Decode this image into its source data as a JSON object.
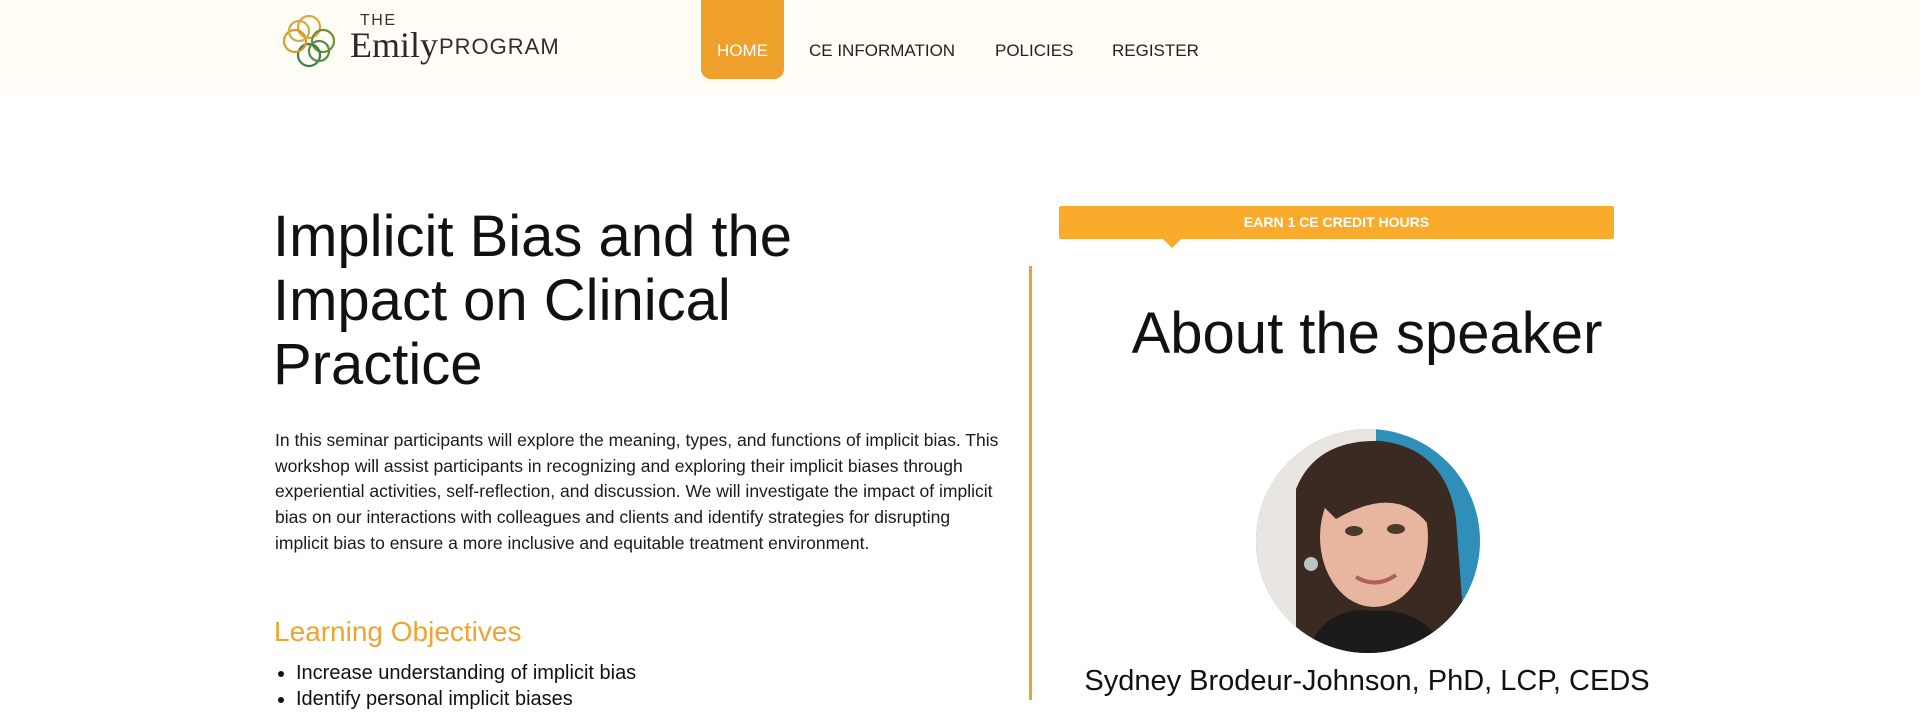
{
  "brand": {
    "logo_the": "THE",
    "logo_emily": "Emily",
    "logo_program": "PROGRAM",
    "accent": "#f0a12b",
    "banner_color": "#fbab2c",
    "divider_color": "#e7a33d"
  },
  "nav": {
    "items": [
      {
        "label": "HOME",
        "active": true
      },
      {
        "label": "CE INFORMATION",
        "active": false
      },
      {
        "label": "POLICIES",
        "active": false
      },
      {
        "label": "REGISTER",
        "active": false
      }
    ]
  },
  "main": {
    "title": "Implicit Bias and the Impact on Clinical Practice",
    "intro": "In this seminar participants will explore the meaning, types, and functions of implicit bias. This workshop will assist participants in recognizing and exploring their implicit biases through experiential activities, self-reflection, and discussion. We will investigate the impact of implicit bias on our interactions with colleagues and clients and identify strategies for disrupting implicit bias to ensure a more inclusive and equitable treatment environment.",
    "objectives_heading": "Learning Objectives",
    "objectives": [
      "Increase understanding of implicit bias",
      "Identify personal implicit biases"
    ]
  },
  "sidebar": {
    "ce_banner": "EARN 1 CE CREDIT HOURS",
    "about_heading": "About the speaker",
    "speaker_name": "Sydney Brodeur-Johnson, PhD, LCP, CEDS"
  }
}
